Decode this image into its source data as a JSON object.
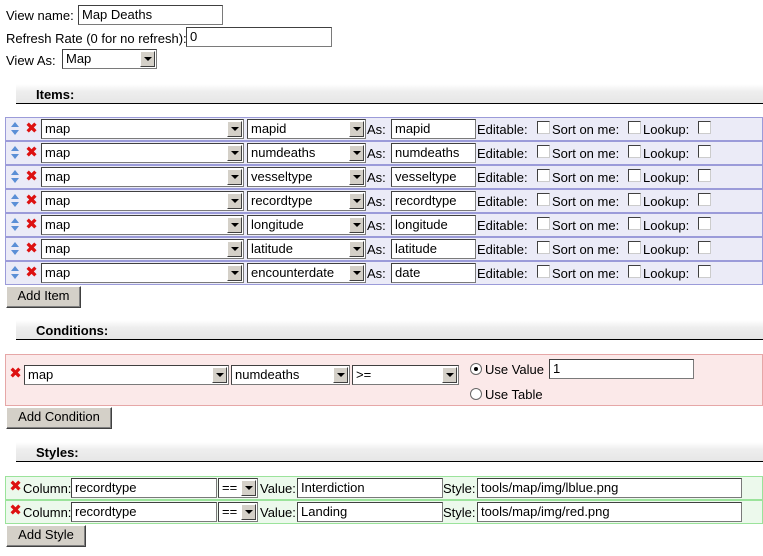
{
  "header": {
    "view_name_label": "View name:",
    "view_name_value": "Map Deaths",
    "refresh_label": "Refresh Rate (0 for no refresh):",
    "refresh_value": "0",
    "view_as_label": "View As:",
    "view_as_value": "Map"
  },
  "items_section": {
    "title": "Items:",
    "as_label": "As:",
    "editable_label": "Editable:",
    "sort_label": "Sort on me:",
    "lookup_label": "Lookup:",
    "rows": [
      {
        "table": "map",
        "column": "mapid",
        "alias": "mapid"
      },
      {
        "table": "map",
        "column": "numdeaths",
        "alias": "numdeaths"
      },
      {
        "table": "map",
        "column": "vesseltype",
        "alias": "vesseltype"
      },
      {
        "table": "map",
        "column": "recordtype",
        "alias": "recordtype"
      },
      {
        "table": "map",
        "column": "longitude",
        "alias": "longitude"
      },
      {
        "table": "map",
        "column": "latitude",
        "alias": "latitude"
      },
      {
        "table": "map",
        "column": "encounterdate",
        "alias": "date"
      }
    ],
    "add_button": "Add Item"
  },
  "conditions_section": {
    "title": "Conditions:",
    "rows": [
      {
        "table": "map",
        "column": "numdeaths",
        "operator": ">=",
        "use_value_label": "Use Value",
        "value": "1",
        "use_table_label": "Use Table"
      }
    ],
    "add_button": "Add Condition"
  },
  "styles_section": {
    "title": "Styles:",
    "column_label": "Column:",
    "value_label": "Value:",
    "style_label": "Style:",
    "rows": [
      {
        "column": "recordtype",
        "operator": "==",
        "value": "Interdiction",
        "style": "tools/map/img/lblue.png"
      },
      {
        "column": "recordtype",
        "operator": "==",
        "value": "Landing",
        "style": "tools/map/img/red.png"
      }
    ],
    "add_button": "Add Style"
  },
  "icons": {
    "move": "up-down-arrows-icon",
    "delete": "red-x-delete-icon"
  },
  "colors": {
    "items_bg": "#ebebf7",
    "items_border": "#9b9bd9",
    "conditions_bg": "#fbe9e9",
    "conditions_border": "#e6a7a7",
    "styles_bg": "#ecf9ec",
    "styles_border": "#9be39b",
    "delete_icon": "#dd1111",
    "move_icon": "#5b8fd6"
  }
}
